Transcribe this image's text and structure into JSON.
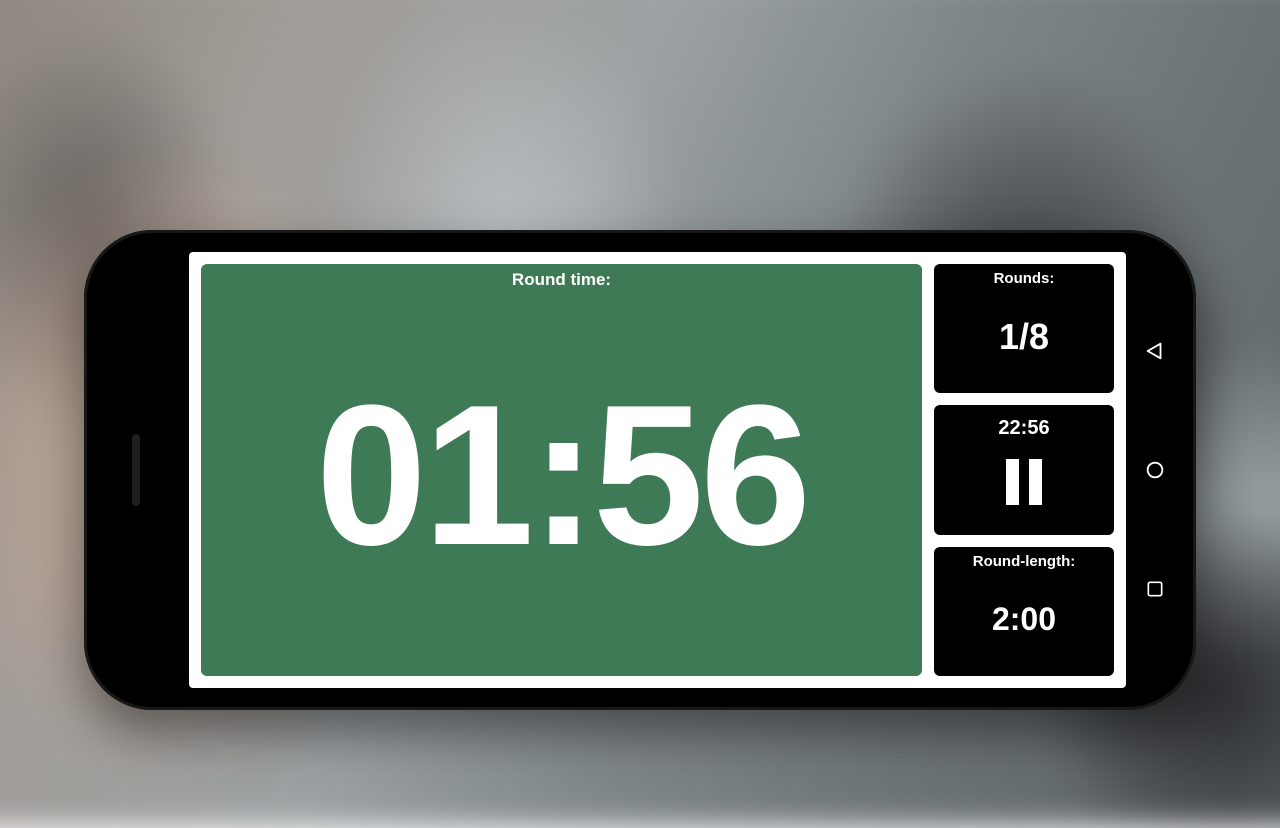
{
  "timer": {
    "round_time_label": "Round time:",
    "round_time_value": "01:56"
  },
  "side": {
    "rounds_label": "Rounds:",
    "rounds_value": "1/8",
    "total_time": "22:56",
    "round_length_label": "Round-length:",
    "round_length_value": "2:00"
  },
  "colors": {
    "panel_green": "#3e7a55",
    "card_black": "#000000"
  }
}
